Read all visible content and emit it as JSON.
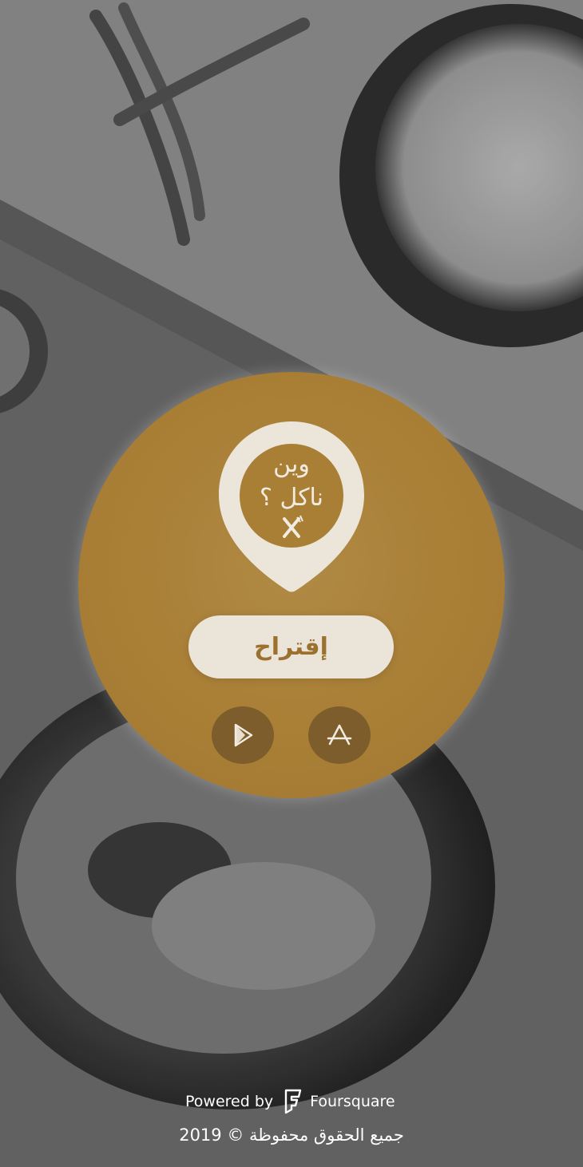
{
  "app": {
    "logo_line1": "وين",
    "logo_line2": "ناكل ؟"
  },
  "main": {
    "suggest_label": "إقتراح"
  },
  "stores": [
    {
      "name": "google-play",
      "icon": "play-store-icon"
    },
    {
      "name": "app-store",
      "icon": "app-store-icon"
    }
  ],
  "footer": {
    "powered_by_prefix": "Powered by",
    "powered_by_brand": "Foursquare",
    "copyright": "جميع الحقوق محفوظة © 2019"
  },
  "colors": {
    "circle": "#a97e35",
    "button_bg": "#ebe5d9",
    "button_text": "#9c7130",
    "store_button": "#7d5d2b"
  }
}
